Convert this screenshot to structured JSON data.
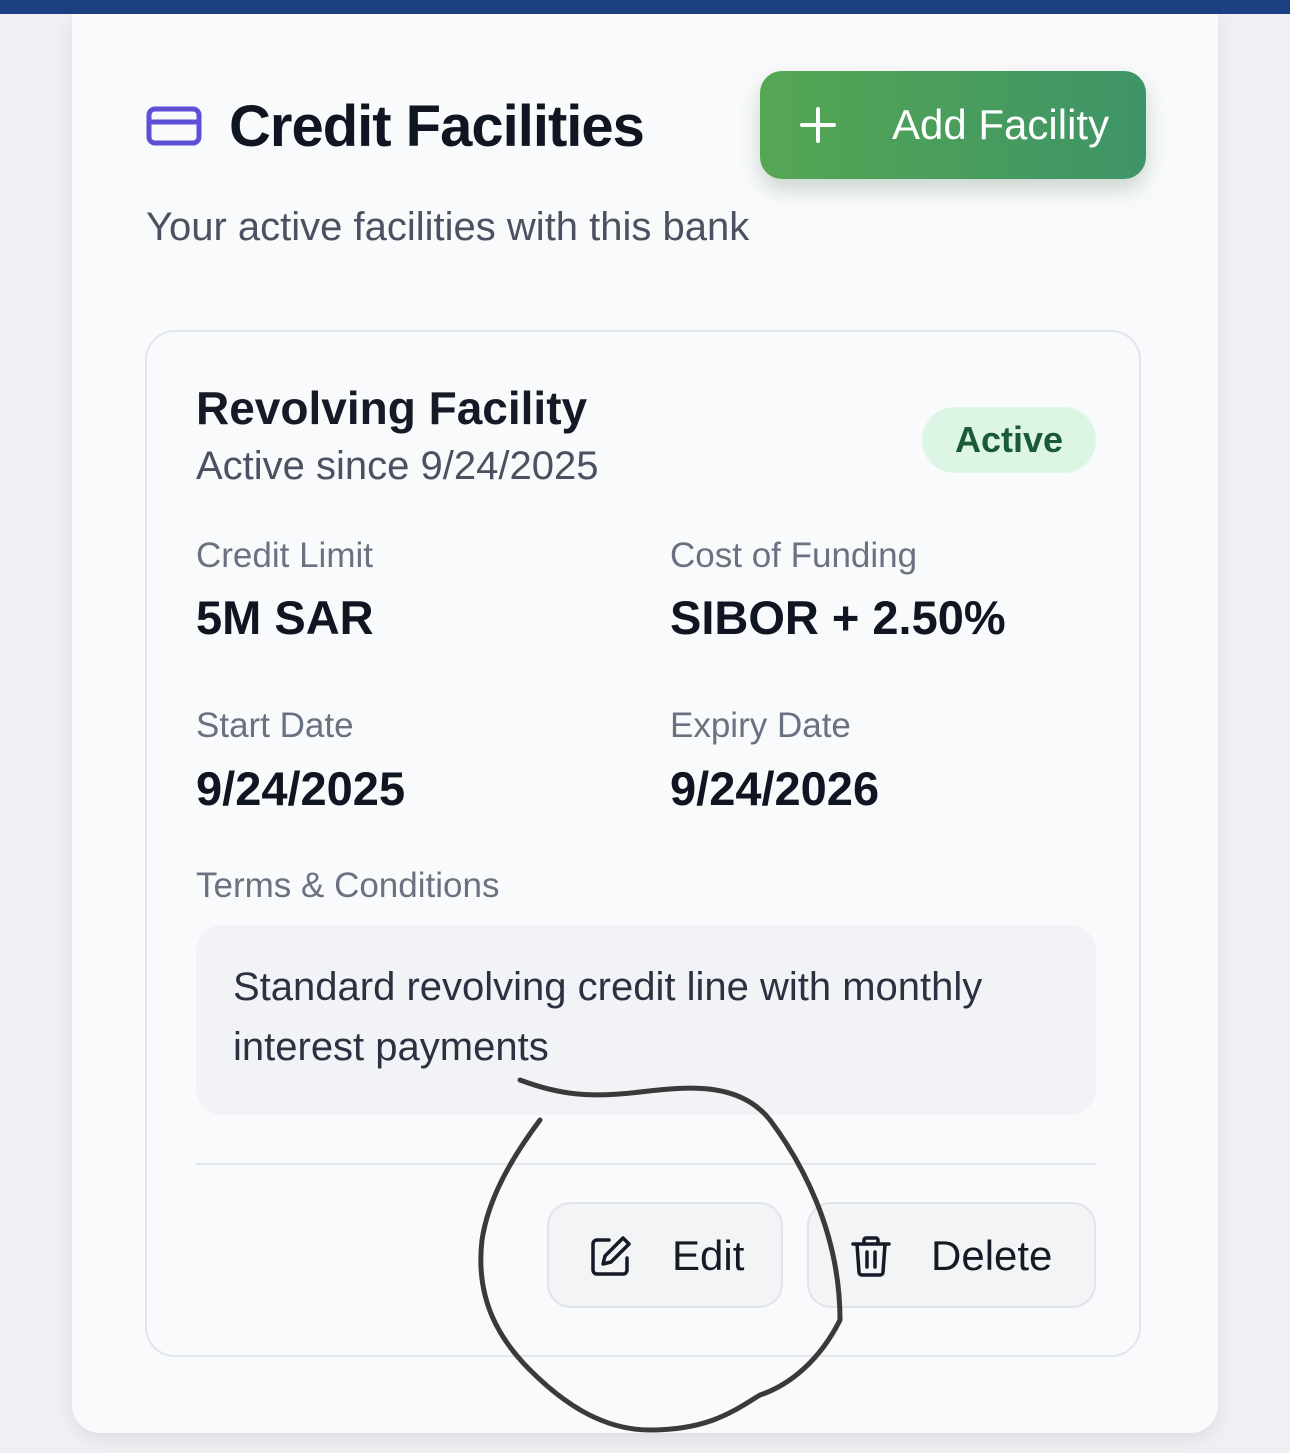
{
  "header": {
    "title": "Credit Facilities",
    "subtitle": "Your active facilities with this bank",
    "add_button_label": "Add Facility"
  },
  "facility": {
    "name": "Revolving Facility",
    "since": "Active since 9/24/2025",
    "status": "Active",
    "fields": {
      "credit_limit_label": "Credit Limit",
      "credit_limit_value": "5M SAR",
      "cost_label": "Cost of Funding",
      "cost_value": "SIBOR + 2.50%",
      "start_label": "Start Date",
      "start_value": "9/24/2025",
      "expiry_label": "Expiry Date",
      "expiry_value": "9/24/2026"
    },
    "terms_label": "Terms & Conditions",
    "terms_text": "Standard revolving credit line with monthly interest payments",
    "edit_label": "Edit",
    "delete_label": "Delete"
  },
  "colors": {
    "top_bar": "#1b3f80",
    "accent_icon": "#5b50d6",
    "add_button_start": "#55a653",
    "add_button_end": "#3e9467",
    "status_badge_bg": "#dcf5e5",
    "status_badge_text": "#1b5a37",
    "annotation_stroke": "#3a3a3a"
  },
  "icons": {
    "header": "credit-card-icon",
    "add": "plus-icon",
    "edit": "edit-icon",
    "delete": "trash-icon"
  }
}
